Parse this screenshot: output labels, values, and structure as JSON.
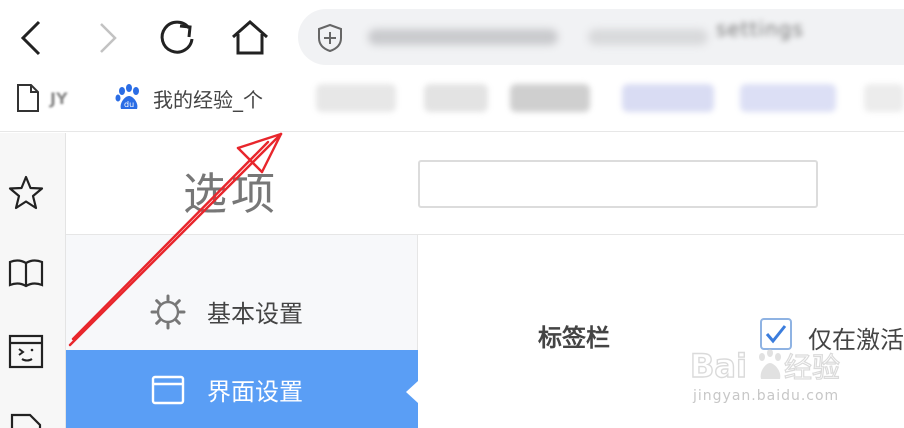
{
  "browser": {
    "address_bar": {
      "visible_url_fragment": "settings"
    },
    "bookmarks": [
      {
        "label": "JY",
        "icon": "file-icon"
      },
      {
        "label": "我的经验_个",
        "icon": "baidu-paw-icon"
      }
    ]
  },
  "page": {
    "title": "选项",
    "search": {
      "value": "",
      "placeholder": ""
    },
    "menu": {
      "items": [
        {
          "label": "基本设置",
          "icon": "gear-icon",
          "active": false
        },
        {
          "label": "界面设置",
          "icon": "window-icon",
          "active": true
        }
      ]
    },
    "section": {
      "label": "标签栏",
      "checkbox_label": "仅在激活",
      "checkbox_checked": true
    }
  },
  "watermark": {
    "logo_text": "Bai du 经验",
    "url": "jingyan.baidu.com"
  },
  "colors": {
    "active_menu": "#5a9ef5",
    "annotation_arrow": "#e8262c",
    "checkbox_check": "#3b7ddd"
  }
}
